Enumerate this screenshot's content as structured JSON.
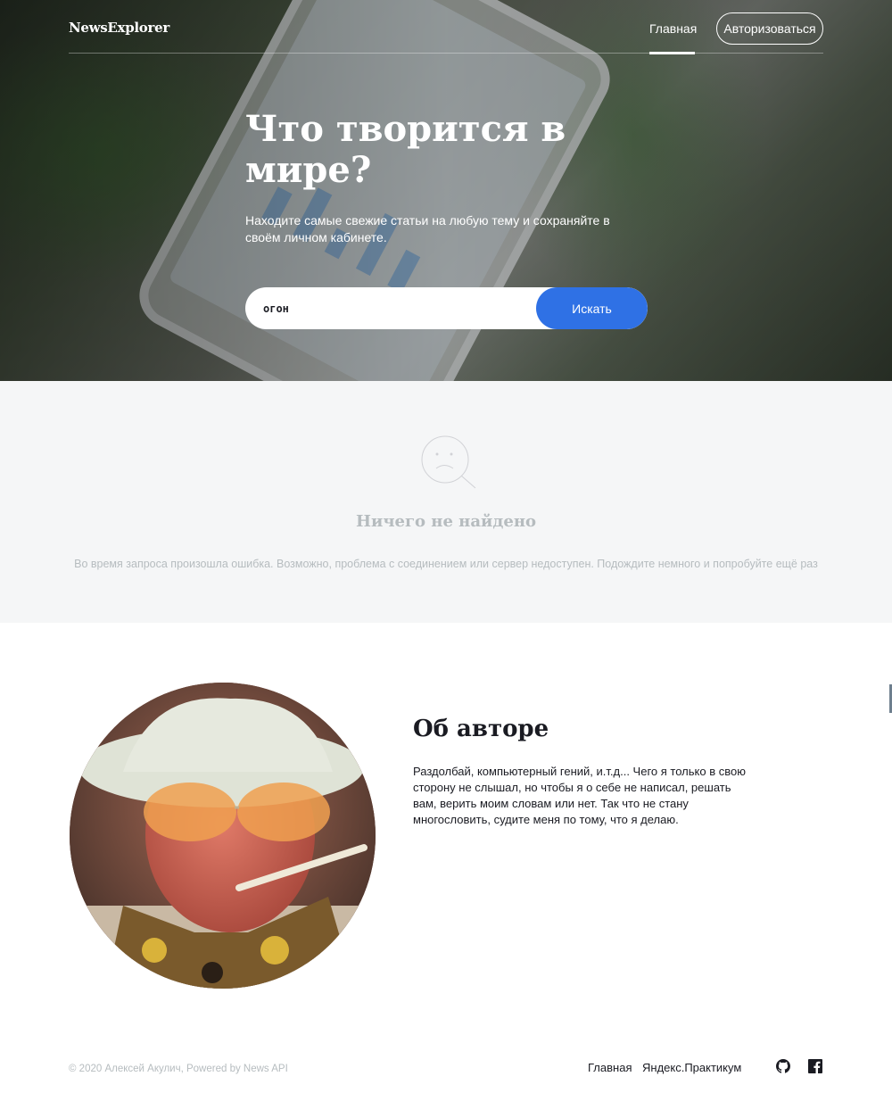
{
  "header": {
    "logo": "NewsExplorer",
    "nav_home": "Главная",
    "auth_button": "Авторизоваться"
  },
  "hero": {
    "title": "Что творится в мире?",
    "subtitle": "Находите самые свежие статьи на любую тему и сохраняйте в своём личном кабинете.",
    "search_value": "огон",
    "search_button": "Искать"
  },
  "not_found": {
    "title": "Ничего не найдено",
    "text": "Во время запроса произошла ошибка. Возможно, проблема с соединением или сервер недоступен. Подождите немного и попробуйте ещё раз"
  },
  "about": {
    "title": "Об авторе",
    "text": "Раздолбай, компьютерный гений, и.т.д... Чего я только в свою сторону не слышал, но чтобы я о себе не написал, решать вам, верить моим словам или нет. Так что не стану многословить, судите меня по тому, что я делаю."
  },
  "footer": {
    "copyright": "© 2020 Алексей Акулич, Powered by News API",
    "link_home": "Главная",
    "link_practicum": "Яндекс.Практикум",
    "icons": [
      "github-icon",
      "facebook-icon"
    ]
  },
  "colors": {
    "accent": "#2f71e5",
    "muted_text": "#b6bcbf",
    "section_bg": "#f5f6f7",
    "text": "#1a1b22"
  }
}
